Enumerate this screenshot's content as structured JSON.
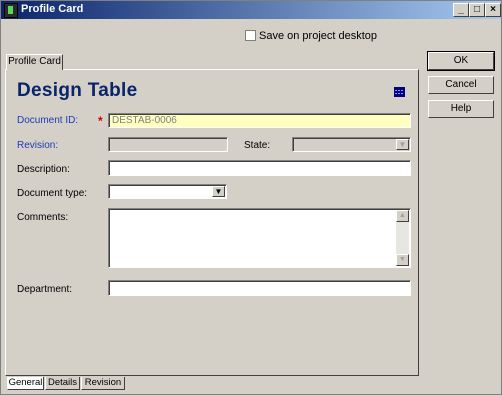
{
  "window": {
    "title": "Profile Card",
    "min_label": "_",
    "max_label": "□",
    "close_label": "×"
  },
  "save_desktop": {
    "label": "Save on project desktop",
    "checked": false
  },
  "tabs": {
    "top_label": "Profile Card"
  },
  "form": {
    "heading": "Design Table",
    "document_id": {
      "label": "Document ID:",
      "required_mark": "*",
      "value": "DESTAB-0006"
    },
    "revision": {
      "label": "Revision:",
      "value": ""
    },
    "state": {
      "label": "State:",
      "value": "",
      "arrow": "▼"
    },
    "description": {
      "label": "Description:",
      "value": ""
    },
    "document_type": {
      "label": "Document type:",
      "value": "",
      "arrow": "▼"
    },
    "comments": {
      "label": "Comments:",
      "value": "",
      "up": "▲",
      "down": "▼"
    },
    "department": {
      "label": "Department:",
      "value": ""
    }
  },
  "buttons": {
    "ok": "OK",
    "cancel": "Cancel",
    "help": "Help"
  },
  "bottom_tabs": [
    "General",
    "Details",
    "Revision"
  ],
  "colors": {
    "accent": "#0a246a",
    "label_blue": "#1d3bb5",
    "required": "#d00000",
    "id_field_bg": "#ffffc0"
  }
}
